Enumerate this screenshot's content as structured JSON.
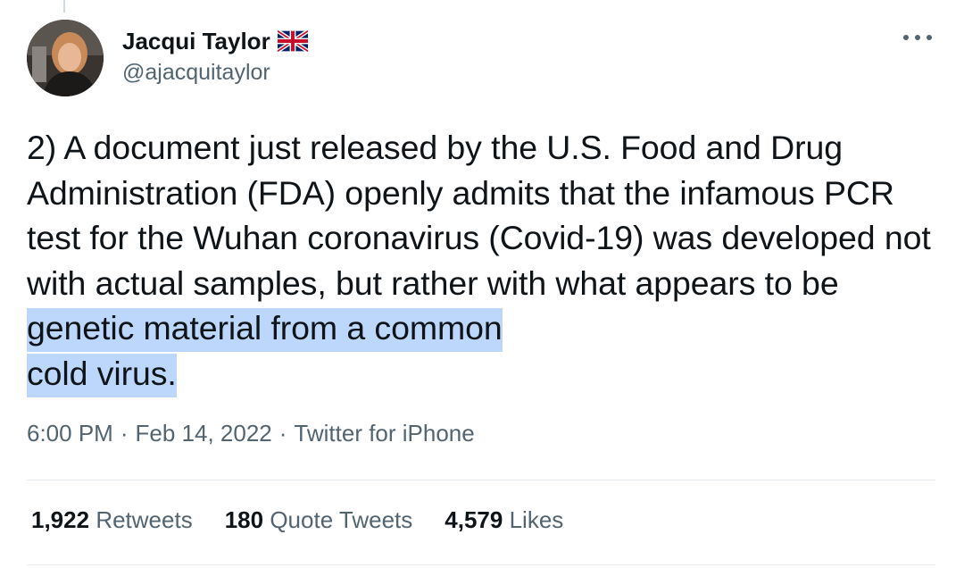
{
  "author": {
    "display_name": "Jacqui Taylor",
    "handle": "@ajacquitaylor",
    "flag_icon": "uk-flag-emoji"
  },
  "tweet": {
    "text_before": "2) A document just released by the U.S. Food and Drug Administration (FDA) openly admits that the infamous PCR test for the Wuhan coronavirus (Covid-19) was developed not with actual samples, but rather with what appears to be ",
    "text_highlighted_1": "genetic material from a common",
    "text_highlighted_2": "cold virus."
  },
  "meta": {
    "time": "6:00 PM",
    "date": "Feb 14, 2022",
    "source": "Twitter for iPhone",
    "separator": "·"
  },
  "stats": {
    "retweets_count": "1,922",
    "retweets_label": "Retweets",
    "quotes_count": "180",
    "quotes_label": "Quote Tweets",
    "likes_count": "4,579",
    "likes_label": "Likes"
  },
  "colors": {
    "highlight": "#bcd7fb",
    "secondary_text": "#536471",
    "primary_text": "#0f1419"
  }
}
